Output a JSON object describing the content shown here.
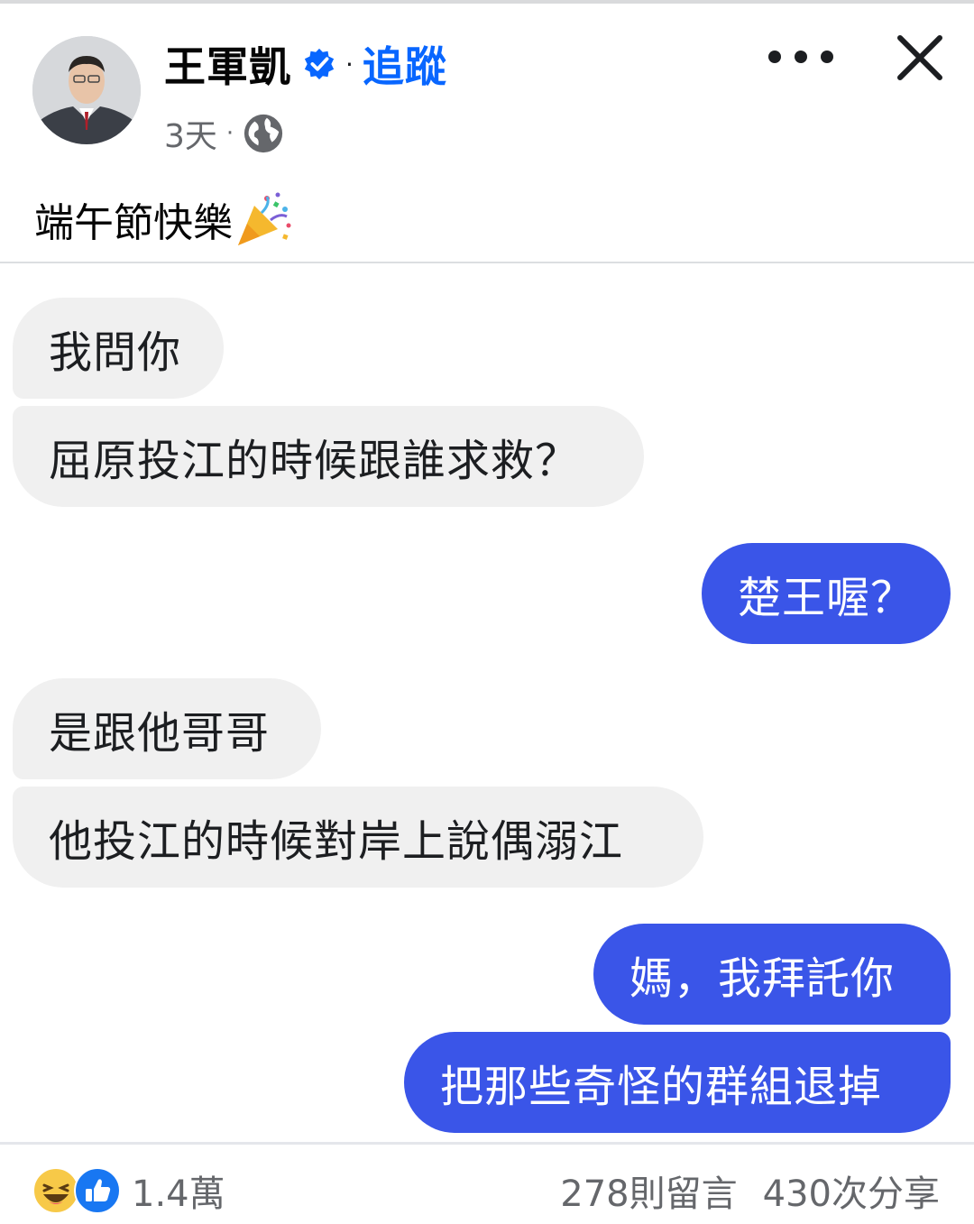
{
  "post": {
    "author": "王軍凱",
    "separator": "·",
    "follow_label": "追蹤",
    "time": "3天",
    "meta_separator": "·",
    "privacy_icon": "globe-icon",
    "caption": "端午節快樂",
    "caption_emoji": "party-popper-icon"
  },
  "chat": {
    "messages": [
      {
        "side": "incoming",
        "text": "我問你"
      },
      {
        "side": "incoming",
        "text": "屈原投江的時候跟誰求救？"
      },
      {
        "side": "outgoing",
        "text": "楚王喔？"
      },
      {
        "side": "incoming",
        "text": "是跟他哥哥"
      },
      {
        "side": "incoming",
        "text": "他投江的時候對岸上說偶溺江"
      },
      {
        "side": "outgoing",
        "text": "媽，我拜託你"
      },
      {
        "side": "outgoing",
        "text": "把那些奇怪的群組退掉"
      }
    ]
  },
  "footer": {
    "reaction_icons": [
      "haha-icon",
      "like-icon"
    ],
    "reaction_count": "1.4萬",
    "comments": "278則留言",
    "shares": "430次分享"
  },
  "colors": {
    "follow": "#0866ff",
    "outgoing_bubble": "#3a55e8",
    "incoming_bubble": "#f0f0f0",
    "meta_text": "#65676b"
  }
}
